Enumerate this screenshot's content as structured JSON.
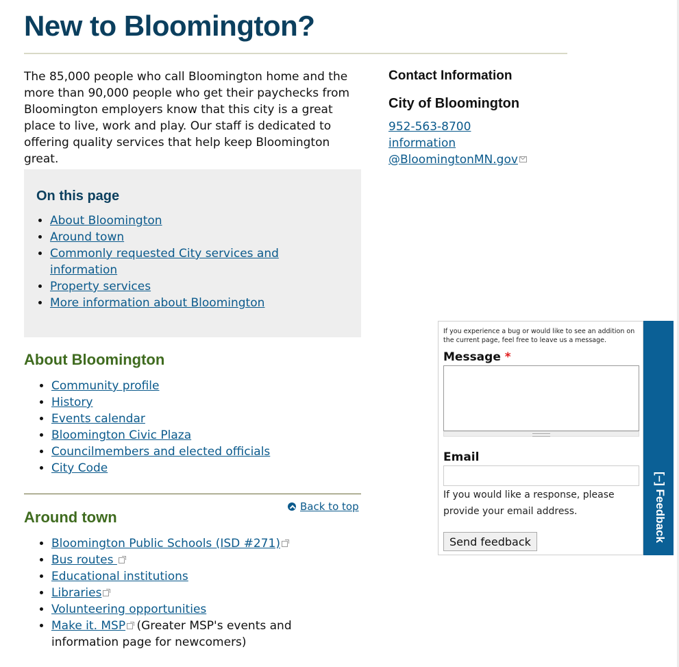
{
  "page": {
    "title": "New to Bloomington?",
    "intro": "The 85,000 people who call Bloomington home and the more than 90,000 people who get their paychecks from Bloomington employers know that this city is a great place to live, work and play. Our staff is dedicated to offering quality services that help keep Bloomington great."
  },
  "contact": {
    "heading": "Contact Information",
    "org": "City of Bloomington",
    "phone": "952-563-8700",
    "email_line1": "information",
    "email_line2": "@BloomingtonMN.gov",
    "email_icon": "mail-icon"
  },
  "toc": {
    "heading": "On this page",
    "items": [
      {
        "label": "About Bloomington"
      },
      {
        "label": "Around town"
      },
      {
        "label": "Commonly requested City services and information"
      },
      {
        "label": "Property services"
      },
      {
        "label": "More information about Bloomington"
      }
    ]
  },
  "about": {
    "heading": "About Bloomington",
    "items": [
      {
        "label": "Community profile"
      },
      {
        "label": "History"
      },
      {
        "label": "Events calendar"
      },
      {
        "label": "Bloomington Civic Plaza"
      },
      {
        "label": "Councilmembers and elected officials"
      },
      {
        "label": "City Code"
      }
    ]
  },
  "back_to_top": {
    "label": "Back to top",
    "icon": "chevron-up-circle-icon"
  },
  "around": {
    "heading": "Around town",
    "items": [
      {
        "label": "Bloomington Public Schools (ISD #271)",
        "external": true
      },
      {
        "label": "Bus routes ",
        "external": true
      },
      {
        "label": "Educational institutions",
        "external": false
      },
      {
        "label": "Libraries",
        "external": true
      },
      {
        "label": "Volunteering opportunities",
        "external": false
      },
      {
        "label": "Make it. MSP",
        "external": true,
        "note": " (Greater MSP's events and information page for newcomers)"
      }
    ]
  },
  "feedback": {
    "help": "If you experience a bug or would like to see an addition on the current page, feel free to leave us a message.",
    "message_label": "Message",
    "required_mark": "*",
    "message_value": "",
    "email_label": "Email",
    "email_value": "",
    "email_help": "If you would like a response, please provide your email address.",
    "submit_label": "Send feedback",
    "tab_label": "[–] Feedback",
    "tab_color": "#0b6096"
  },
  "colors": {
    "title": "#0b3f5e",
    "section_heading": "#3f6b1f",
    "link": "#0b5a8c",
    "toc_background": "#eeeeee"
  }
}
